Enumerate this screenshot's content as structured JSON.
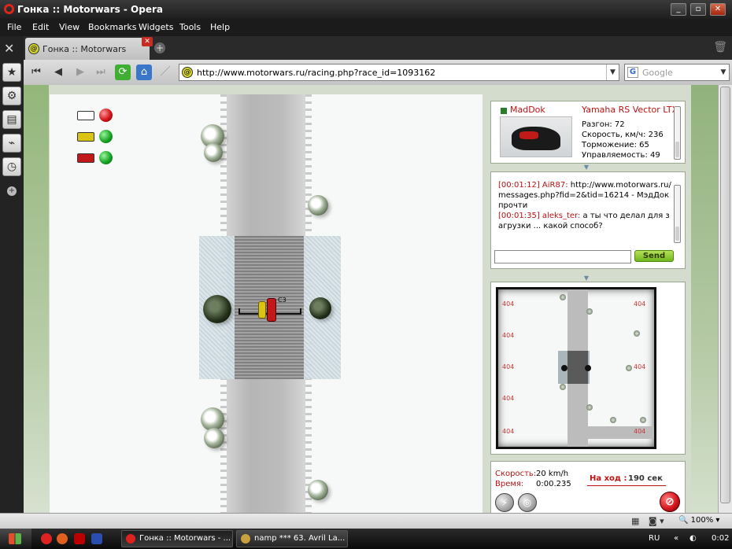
{
  "window": {
    "title": "Гонка :: Motorwars - Opera",
    "minimize": "_",
    "maximize": "▫",
    "close": "✕"
  },
  "menu": [
    "File",
    "Edit",
    "View",
    "Bookmarks",
    "Widgets",
    "Tools",
    "Help"
  ],
  "tabs": [
    {
      "label": "Гонка :: Motorwars",
      "close": "✕"
    }
  ],
  "new_tab": "+",
  "address": {
    "url": "http://www.motorwars.ru/racing.php?race_id=1093162",
    "drop": "▼"
  },
  "search": {
    "placeholder": "Google",
    "engine_letter": "G",
    "drop": "▼"
  },
  "sidebar_icons": [
    "star-icon",
    "gear-icon",
    "chat-icon",
    "satellite-icon",
    "clock-icon",
    "plus-icon"
  ],
  "vehicle_panel": {
    "player_name": "MadDok",
    "vehicle_name": "Yamaha RS Vector LTX",
    "stats": [
      "Разгон: 72",
      "Скорость, км/ч: 236",
      "Торможение: 65",
      "Управляемость: 49"
    ]
  },
  "chat": {
    "messages": [
      {
        "time": "[00:01:12]",
        "nick": "AiR87:",
        "text": "http://www.motorwars.ru/messages.php?fid=2&tid=16214 - МэдДок прочти"
      },
      {
        "time": "[00:01:35]",
        "nick": "aleks_ter:",
        "text": "а ты что делал для загрузки ... какой способ?"
      }
    ],
    "input_value": "",
    "send_label": "Send"
  },
  "minimap": {
    "labels": [
      "404",
      "404",
      "404",
      "404",
      "404",
      "404",
      "404",
      "404"
    ]
  },
  "status_panel": {
    "speed_label": "Скорость:",
    "speed_value": "20 km/h",
    "time_label": "Время:",
    "time_value": "0:00.235",
    "turn_label": "На ход :",
    "turn_value": "190 сек"
  },
  "players": [
    {
      "car_color": "#ffffff",
      "status": "red"
    },
    {
      "car_color": "#d9c414",
      "status": "green"
    },
    {
      "car_color": "#c2181a",
      "status": "green"
    }
  ],
  "field": {
    "car_marker": "C3"
  },
  "statusbar": {
    "zoom": "100%"
  },
  "taskbar": {
    "items": [
      {
        "label": "Гонка :: Motorwars - ..."
      },
      {
        "label": "namp *** 63. Avril La..."
      }
    ],
    "lang": "RU",
    "chevrons": "«",
    "clock": "0:02"
  }
}
